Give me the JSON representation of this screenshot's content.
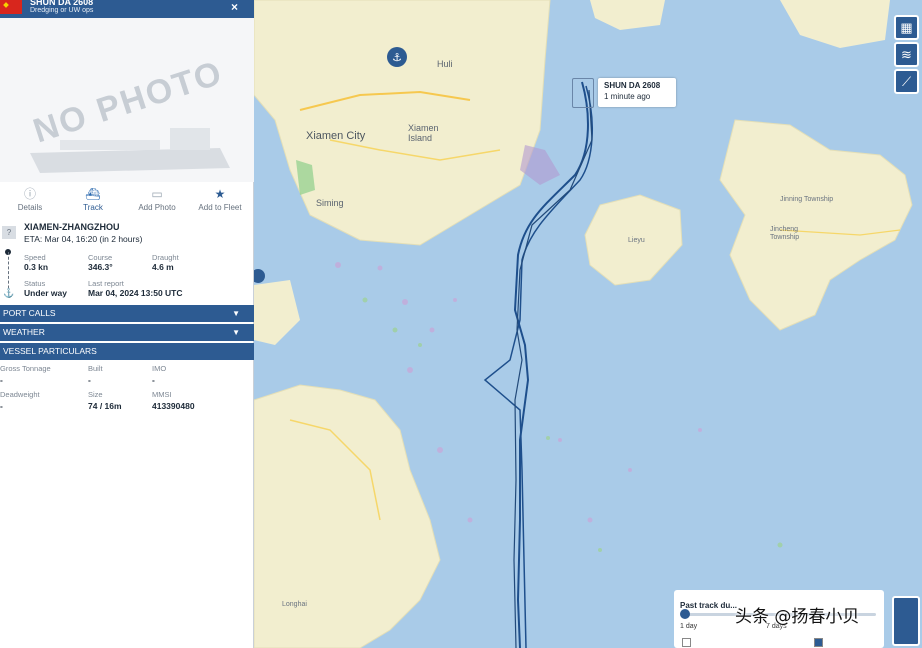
{
  "vessel": {
    "name": "SHUN DA 2608",
    "type": "Dredging or UW ops",
    "photo_placeholder": "NO PHOTO",
    "popup_time": "1 minute ago"
  },
  "actions": [
    {
      "label": "Details",
      "icon": "info-icon"
    },
    {
      "label": "Track",
      "icon": "ship-icon"
    },
    {
      "label": "Add Photo",
      "icon": "camera-icon"
    },
    {
      "label": "Add to Fleet",
      "icon": "star-icon"
    }
  ],
  "voyage": {
    "route": "XIAMEN-ZHANGZHOU",
    "eta": "ETA: Mar 04, 16:20 (in 2 hours)",
    "speed_label": "Speed",
    "speed": "0.3 kn",
    "course_label": "Course",
    "course": "346.3°",
    "draught_label": "Draught",
    "draught": "4.6 m",
    "status_label": "Status",
    "status": "Under way",
    "last_report_label": "Last report",
    "last_report": "Mar 04, 2024 13:50 UTC"
  },
  "sections": {
    "port_calls": "PORT CALLS",
    "weather": "WEATHER",
    "vessel_particulars": "VESSEL PARTICULARS"
  },
  "particulars": {
    "gross_tonnage_label": "Gross Tonnage",
    "gross_tonnage": "-",
    "built_label": "Built",
    "built": "-",
    "imo_label": "IMO",
    "imo": "-",
    "deadweight_label": "Deadweight",
    "deadweight": "-",
    "size_label": "Size",
    "size": "74 / 16m",
    "mmsi_label": "MMSI",
    "mmsi": "413390480"
  },
  "map": {
    "labels": {
      "hulli": "Huli",
      "xiamen_city": "Xiamen City",
      "xiamen_island": "Xiamen\nIsland",
      "siming": "Siming",
      "lieyu": "Lieyu",
      "jinning": "Jinning Township",
      "jincheng": "Jincheng\nTownship",
      "longhai": "Longhai"
    }
  },
  "past_track": {
    "title": "Past track du...",
    "min": "1 day",
    "mid": "7 days"
  },
  "watermark": "头条 @扬春小贝",
  "colors": {
    "sea": "#a9cbe8",
    "land": "#f2eecf",
    "accent": "#2d5b92",
    "track": "#1e4f8c"
  }
}
